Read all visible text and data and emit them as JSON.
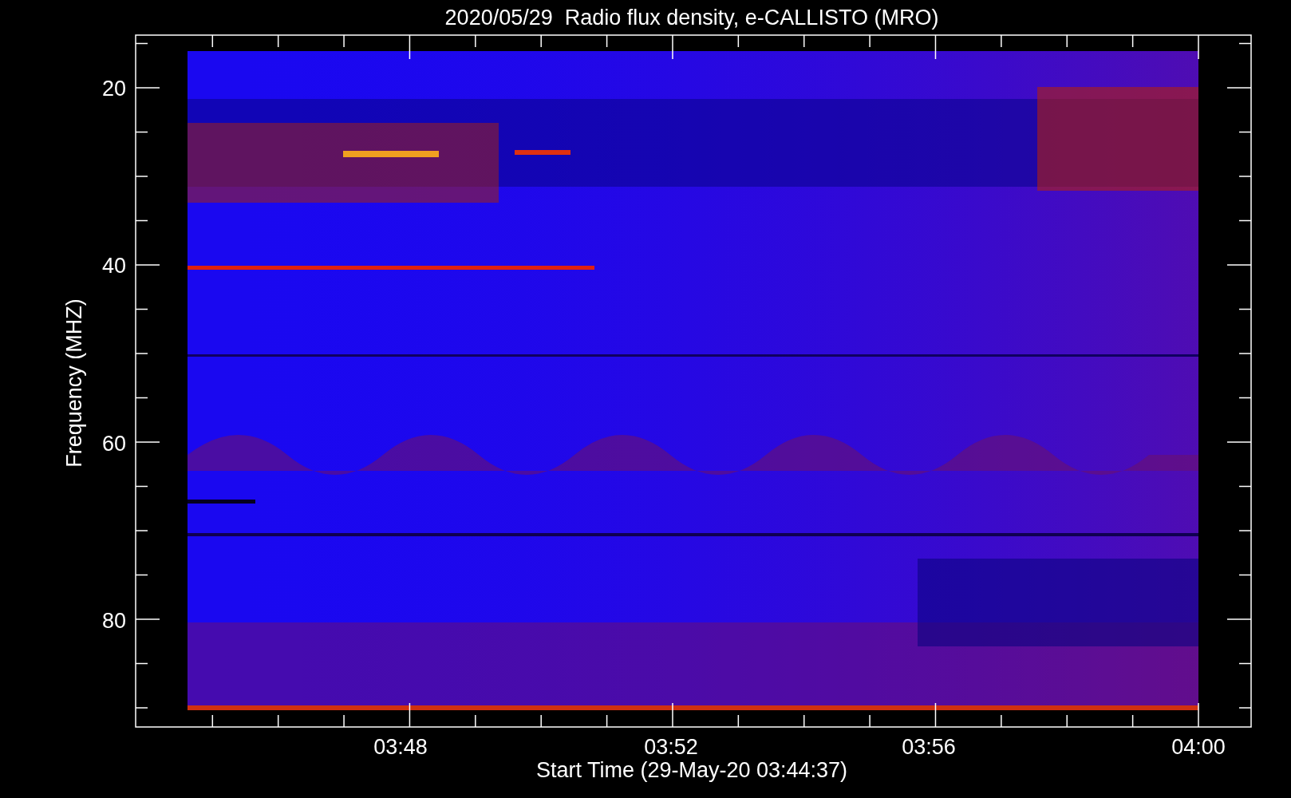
{
  "title": "2020/05/29  Radio flux density, e-CALLISTO (MRO)",
  "y_axis": {
    "label": "Frequency (MHZ)",
    "ticks": [
      "20",
      "40",
      "60",
      "80"
    ]
  },
  "x_axis": {
    "label": "Start Time (29-May-20 03:44:37)",
    "ticks": [
      "03:48",
      "03:52",
      "03:56",
      "04:00"
    ]
  }
}
